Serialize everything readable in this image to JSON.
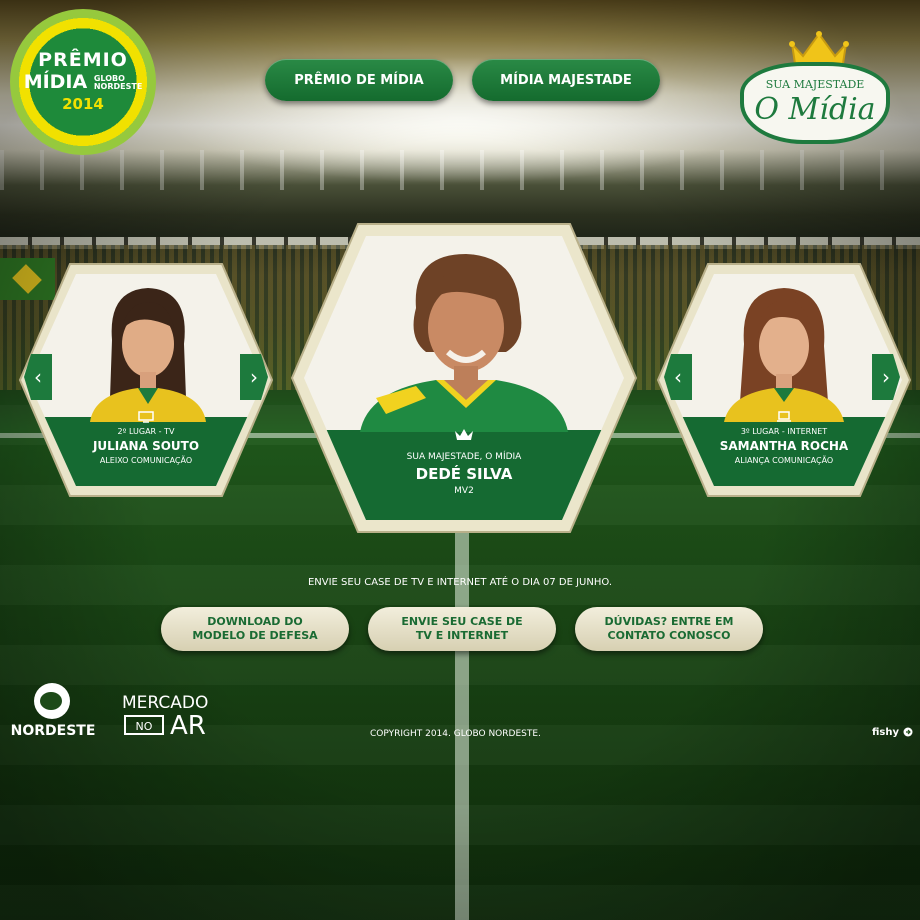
{
  "header": {
    "logo": {
      "line1": "PRÊMIO",
      "line2a": "MÍDIA",
      "line2b_1": "GLOBO",
      "line2b_2": "NORDESTE",
      "line3": "2014"
    },
    "nav": [
      {
        "label": "PRÊMIO DE MÍDIA"
      },
      {
        "label": "MÍDIA MAJESTADE"
      }
    ],
    "crest": {
      "small": "SUA MAJESTADE",
      "big": "O Mídia"
    }
  },
  "cards": {
    "left": {
      "place": "2º LUGAR - TV",
      "name": "JULIANA SOUTO",
      "agency": "ALEIXO COMUNICAÇÃO",
      "prev": "‹",
      "next": "›"
    },
    "center": {
      "place": "SUA MAJESTADE, O MÍDIA",
      "name": "DEDÉ SILVA",
      "agency": "MV2"
    },
    "right": {
      "place": "3º LUGAR - INTERNET",
      "name": "SAMANTHA ROCHA",
      "agency": "ALIANÇA COMUNICAÇÃO",
      "prev": "‹",
      "next": "›"
    }
  },
  "deadline": "ENVIE SEU CASE DE TV E INTERNET ATÉ O DIA 07 DE JUNHO.",
  "actions": [
    {
      "line1": "DOWNLOAD DO",
      "line2": "MODELO DE DEFESA"
    },
    {
      "line1": "ENVIE SEU CASE DE",
      "line2": "TV E INTERNET"
    },
    {
      "line1": "DÚVIDAS? ENTRE EM",
      "line2": "CONTATO CONOSCO"
    }
  ],
  "footer": {
    "globo": "NORDESTE",
    "mercado": {
      "m": "MERCADO",
      "no": "NO",
      "ar": "AR"
    },
    "copyright": "COPYRIGHT 2014. GLOBO NORDESTE.",
    "credit": "fishy"
  },
  "colors": {
    "brand_green": "#156a32",
    "cream": "#eeead4",
    "yellow": "#f1e100"
  }
}
